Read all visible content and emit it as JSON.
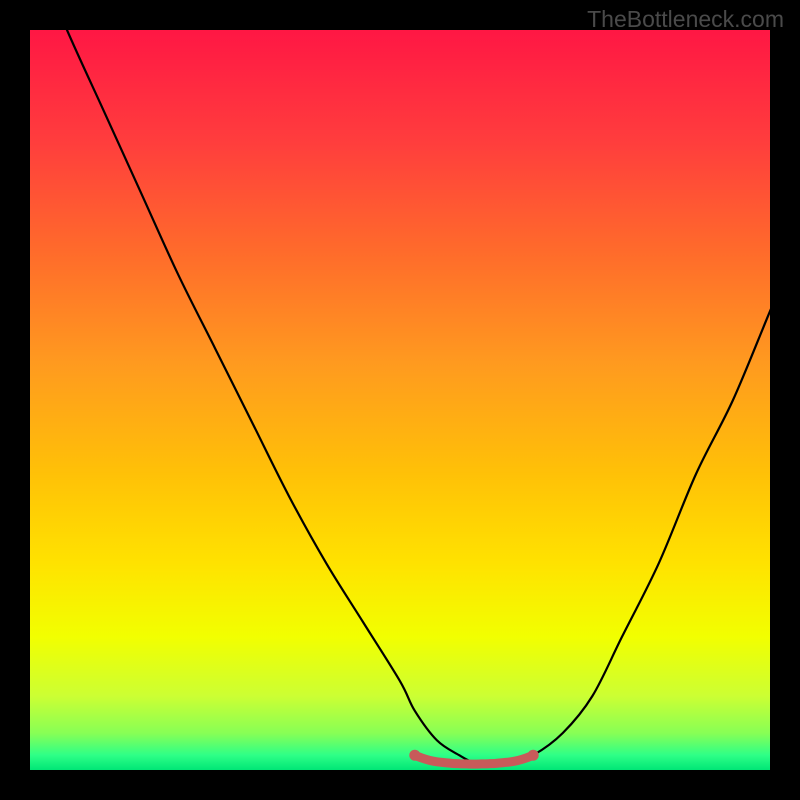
{
  "watermark": "TheBottleneck.com",
  "chart_data": {
    "type": "line",
    "title": "",
    "xlabel": "",
    "ylabel": "",
    "xlim": [
      0,
      100
    ],
    "ylim": [
      0,
      100
    ],
    "series": [
      {
        "name": "bottleneck-curve",
        "x": [
          0,
          5,
          10,
          15,
          20,
          25,
          30,
          35,
          40,
          45,
          50,
          52,
          55,
          58,
          60,
          62,
          65,
          68,
          72,
          76,
          80,
          85,
          90,
          95,
          100,
          105
        ],
        "y": [
          112,
          100,
          89,
          78,
          67,
          57,
          47,
          37,
          28,
          20,
          12,
          8,
          4,
          2,
          1,
          1,
          1,
          2,
          5,
          10,
          18,
          28,
          40,
          50,
          62,
          74
        ]
      },
      {
        "name": "optimal-marker",
        "x": [
          52,
          53,
          54,
          55,
          56,
          57,
          58,
          59,
          60,
          61,
          62,
          63,
          64,
          65,
          66,
          67,
          68
        ],
        "y": [
          2.0,
          1.6,
          1.3,
          1.1,
          1.0,
          0.9,
          0.85,
          0.82,
          0.8,
          0.82,
          0.85,
          0.9,
          1.0,
          1.1,
          1.3,
          1.6,
          2.0
        ]
      }
    ],
    "gradient_stops": [
      {
        "pos": 0.0,
        "color": "#ff1744"
      },
      {
        "pos": 0.15,
        "color": "#ff3d3d"
      },
      {
        "pos": 0.3,
        "color": "#ff6b2b"
      },
      {
        "pos": 0.45,
        "color": "#ff9a1f"
      },
      {
        "pos": 0.6,
        "color": "#ffc107"
      },
      {
        "pos": 0.72,
        "color": "#ffe200"
      },
      {
        "pos": 0.82,
        "color": "#f2ff00"
      },
      {
        "pos": 0.9,
        "color": "#ccff33"
      },
      {
        "pos": 0.95,
        "color": "#88ff55"
      },
      {
        "pos": 0.98,
        "color": "#2eff87"
      },
      {
        "pos": 1.0,
        "color": "#00e676"
      }
    ],
    "marker_color": "#c85a5a",
    "curve_color": "#000000"
  }
}
